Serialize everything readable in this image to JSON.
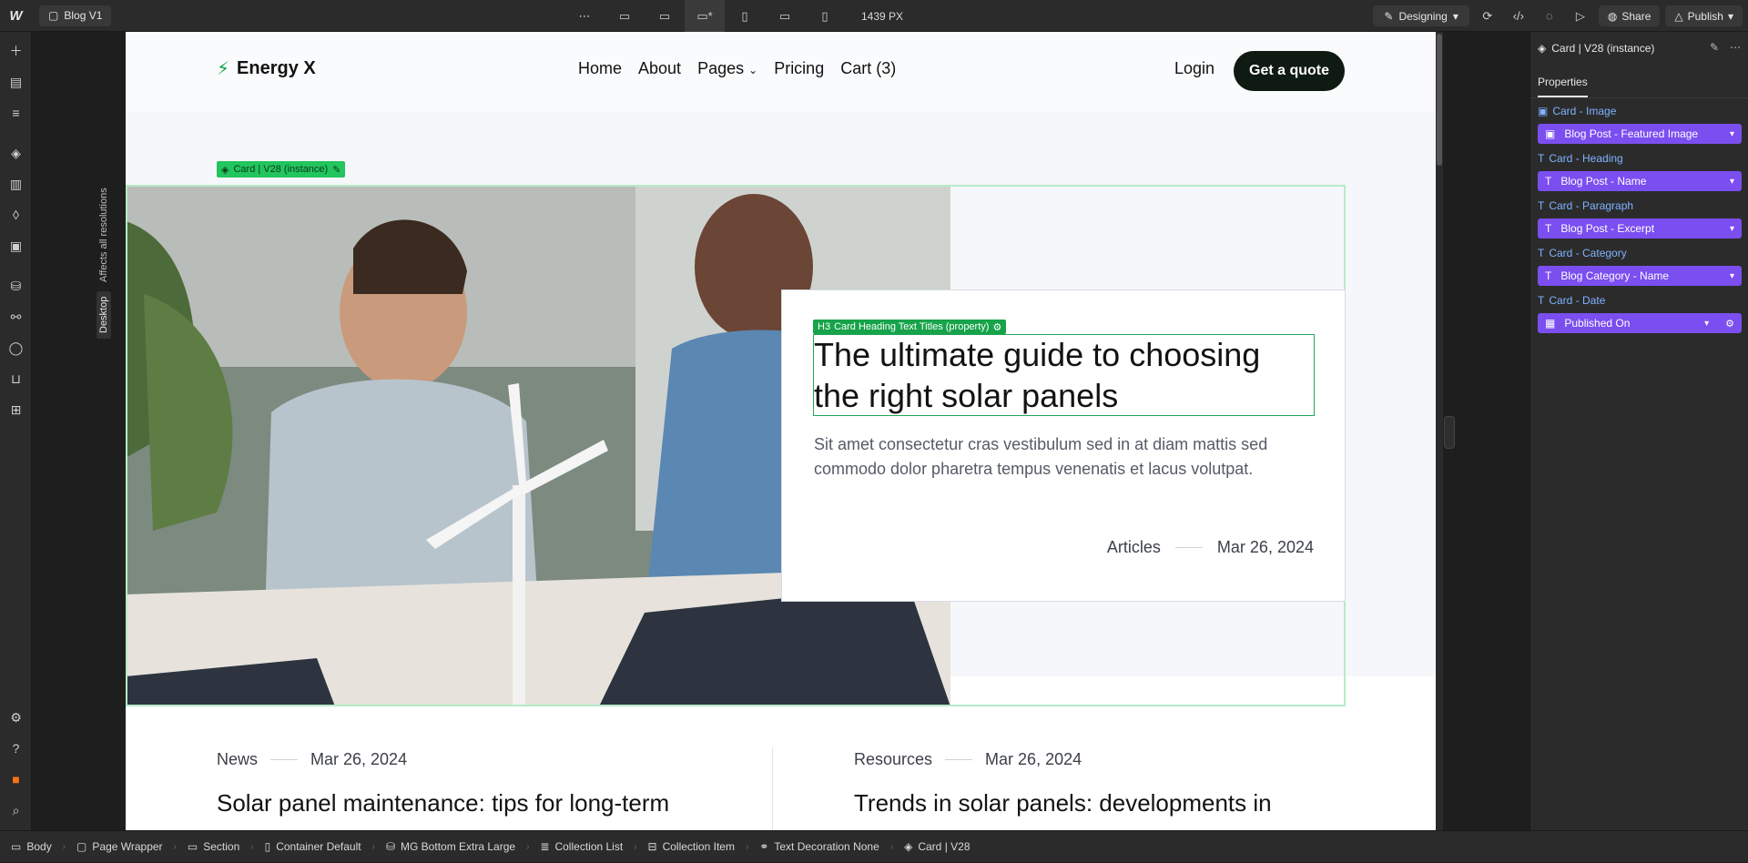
{
  "topbar": {
    "logo": "W",
    "page_name": "Blog V1",
    "more": "⋯",
    "breakpoints": [
      "▭",
      "▭",
      "▭*",
      "▯",
      "▭",
      "▯"
    ],
    "width_readout": "1439 PX",
    "mode": "Designing",
    "share": "Share",
    "publish": "Publish"
  },
  "canvas": {
    "affects_label": "Affects all resolutions",
    "breakpoint_label": "Desktop"
  },
  "site": {
    "brand": "Energy X",
    "nav": [
      "Home",
      "About",
      "Pages",
      "Pricing",
      "Cart (3)"
    ],
    "login": "Login",
    "cta": "Get a quote",
    "card_tag": "Card | V28 (instance)",
    "h3_tag_prefix": "H3",
    "h3_tag": "Card Heading Text Titles (property)",
    "card_heading": "The ultimate guide to choosing the right solar panels",
    "card_excerpt": "Sit amet consectetur cras vestibulum sed in at diam mattis sed commodo dolor pharetra tempus venenatis et lacus volutpat.",
    "card_category": "Articles",
    "card_date": "Mar 26, 2024",
    "posts": [
      {
        "category": "News",
        "date": "Mar 26, 2024",
        "title": "Solar panel maintenance: tips for long-term"
      },
      {
        "category": "Resources",
        "date": "Mar 26, 2024",
        "title": "Trends in solar panels: developments in"
      }
    ]
  },
  "panel": {
    "title": "Card | V28 (instance)",
    "tab": "Properties",
    "props": [
      {
        "label": "Card - Image",
        "value": "Blog Post - Featured Image",
        "icon": "image"
      },
      {
        "label": "Card - Heading",
        "value": "Blog Post - Name",
        "icon": "text"
      },
      {
        "label": "Card - Paragraph",
        "value": "Blog Post - Excerpt",
        "icon": "text"
      },
      {
        "label": "Card - Category",
        "value": "Blog Category - Name",
        "icon": "text"
      },
      {
        "label": "Card - Date",
        "value": "Published On",
        "icon": "calendar"
      }
    ]
  },
  "breadcrumbs": [
    "Body",
    "Page Wrapper",
    "Section",
    "Container Default",
    "MG Bottom Extra Large",
    "Collection List",
    "Collection Item",
    "Text Decoration None",
    "Card | V28"
  ],
  "colors": {
    "accent_green": "#22c55e",
    "prop_purple": "#7b4ef0",
    "cta_dark": "#0f1a12"
  }
}
